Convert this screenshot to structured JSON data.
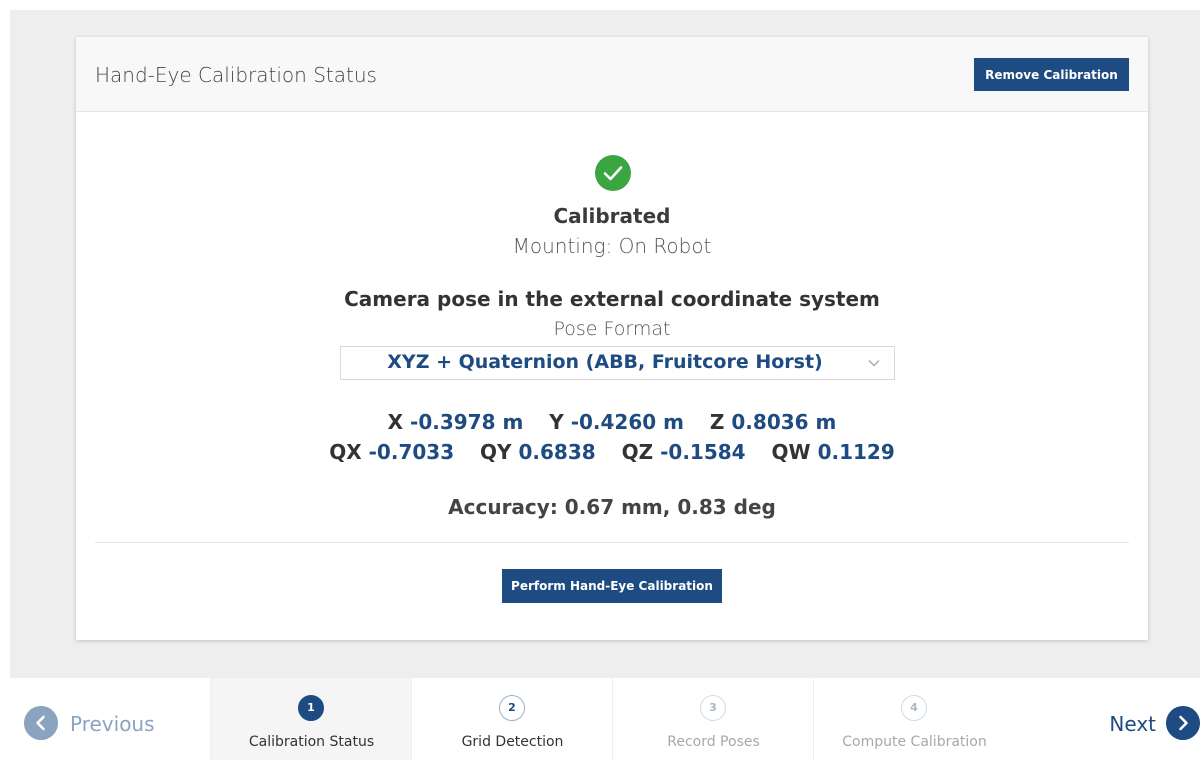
{
  "card": {
    "title": "Hand-Eye Calibration Status",
    "remove_button": "Remove Calibration",
    "status_icon": "check-circle-icon",
    "status": "Calibrated",
    "mounting": "Mounting: On Robot",
    "pose_title": "Camera pose in the external coordinate system",
    "pose_format_label": "Pose Format",
    "pose_format_value": "XYZ + Quaternion (ABB, Fruitcore Horst)",
    "position": [
      {
        "label": "X",
        "value": "-0.3978 m"
      },
      {
        "label": "Y",
        "value": "-0.4260 m"
      },
      {
        "label": "Z",
        "value": "0.8036 m"
      }
    ],
    "quaternion": [
      {
        "label": "QX",
        "value": "-0.7033"
      },
      {
        "label": "QY",
        "value": "0.6838"
      },
      {
        "label": "QZ",
        "value": "-0.1584"
      },
      {
        "label": "QW",
        "value": "0.1129"
      }
    ],
    "accuracy": "Accuracy: 0.67 mm, 0.83 deg",
    "perform_button": "Perform Hand-Eye Calibration"
  },
  "footer": {
    "previous": "Previous",
    "next": "Next",
    "steps": [
      {
        "number": "1",
        "label": "Calibration Status",
        "state": "active"
      },
      {
        "number": "2",
        "label": "Grid Detection",
        "state": "enabled"
      },
      {
        "number": "3",
        "label": "Record Poses",
        "state": "disabled"
      },
      {
        "number": "4",
        "label": "Compute Calibration",
        "state": "disabled"
      }
    ]
  },
  "colors": {
    "accent": "#1e4b81",
    "success": "#3aa541",
    "background": "#eeeeee"
  }
}
